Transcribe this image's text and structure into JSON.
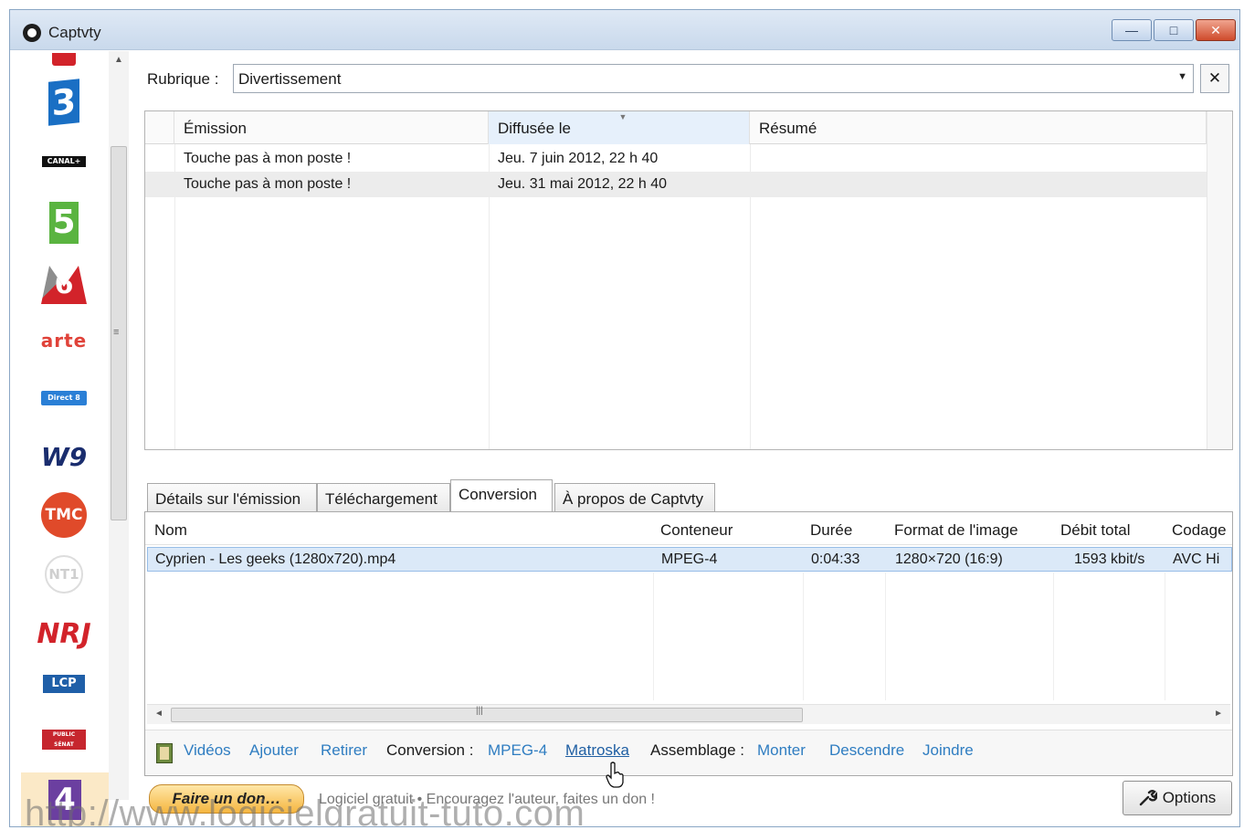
{
  "window": {
    "title": "Captvty",
    "buttons": {
      "minimize": "—",
      "maximize": "□",
      "close": "✕"
    }
  },
  "sidebar": {
    "channels": [
      {
        "id": "france2",
        "label": ""
      },
      {
        "id": "france3",
        "label": "3"
      },
      {
        "id": "canalplus",
        "label": "CANAL+"
      },
      {
        "id": "france5",
        "label": "5"
      },
      {
        "id": "m6",
        "label": "6"
      },
      {
        "id": "arte",
        "label": "arte"
      },
      {
        "id": "direct8",
        "label": "Direct 8"
      },
      {
        "id": "w9",
        "label": "W9"
      },
      {
        "id": "tmc",
        "label": "TMC"
      },
      {
        "id": "nt1",
        "label": "NT1"
      },
      {
        "id": "nrj12",
        "label": "NRJ"
      },
      {
        "id": "lcp",
        "label": "LCP"
      },
      {
        "id": "publicsenat",
        "label": "PUBLIC SÉNAT"
      },
      {
        "id": "france4",
        "label": "4"
      }
    ]
  },
  "rubrique": {
    "label": "Rubrique :",
    "value": "Divertissement",
    "clear": "✕"
  },
  "emissions": {
    "columns": [
      "Émission",
      "Diffusée le",
      "Résumé"
    ],
    "rows": [
      {
        "emission": "Touche pas à mon poste !",
        "date": "Jeu. 7 juin 2012, 22 h 40",
        "resume": ""
      },
      {
        "emission": "Touche pas à mon poste !",
        "date": "Jeu. 31 mai 2012, 22 h 40",
        "resume": ""
      }
    ]
  },
  "tabs": [
    "Détails sur l'émission",
    "Téléchargement",
    "Conversion",
    "À propos de Captvty"
  ],
  "conversion": {
    "columns": [
      "Nom",
      "Conteneur",
      "Durée",
      "Format de l'image",
      "Débit total",
      "Codage"
    ],
    "rows": [
      {
        "nom": "Cyprien - Les geeks (1280x720).mp4",
        "conteneur": "MPEG-4",
        "duree": "0:04:33",
        "format": "1280×720 (16:9)",
        "debit": "1593 kbit/s",
        "codage": "AVC Hi"
      }
    ],
    "actions": {
      "videos": "Vidéos",
      "ajouter": "Ajouter",
      "retirer": "Retirer",
      "conversion_label": "Conversion :",
      "mpeg4": "MPEG-4",
      "matroska": "Matroska",
      "assemblage_label": "Assemblage :",
      "monter": "Monter",
      "descendre": "Descendre",
      "joindre": "Joindre"
    }
  },
  "footer": {
    "don_button": "Faire un don…",
    "don_text": "Logiciel gratuit • Encouragez l'auteur, faites un don !",
    "options": "Options",
    "watermark": "http://www.logicielgratuit-tuto.com"
  },
  "colors": {
    "link": "#2f7dc1",
    "selection": "#dbe9f8",
    "titlebar": "#c9d9ec"
  }
}
